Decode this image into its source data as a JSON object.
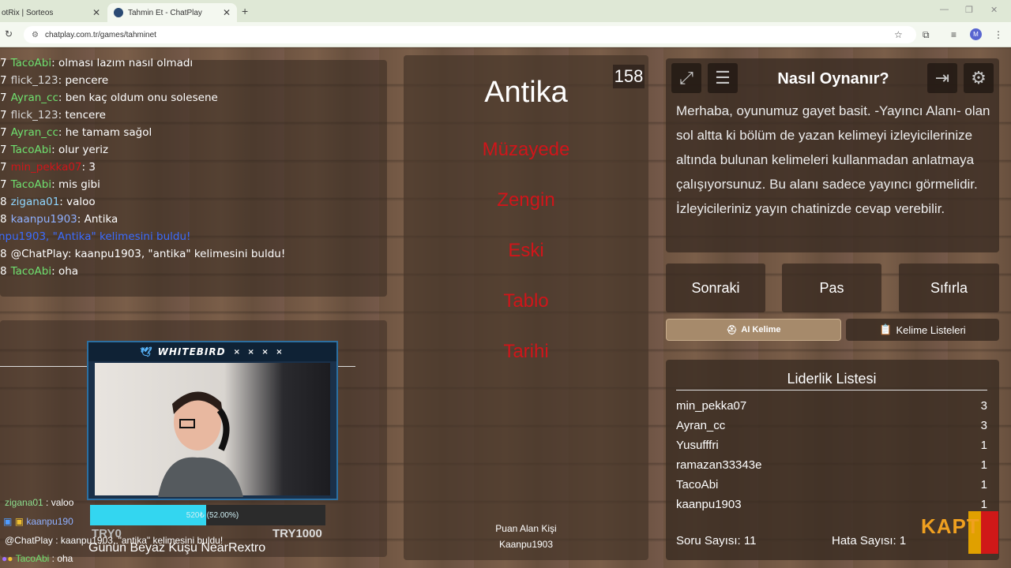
{
  "browser": {
    "tab_inactive": "otRix | Sorteos",
    "tab_active": "Tahmin Et - ChatPlay",
    "url": "chatplay.com.tr/games/tahminet",
    "avatar_letter": "M"
  },
  "chat": [
    {
      "prefix": "7",
      "user": "TacoAbi",
      "color": "#6fe06f",
      "msg": ": olması lazım nasıl olmadı"
    },
    {
      "prefix": "7",
      "user": "flick_123",
      "color": "#d8d8d8",
      "msg": ": pencere"
    },
    {
      "prefix": "7",
      "user": "Ayran_cc",
      "color": "#6fe06f",
      "msg": ": ben kaç oldum onu solesene"
    },
    {
      "prefix": "7",
      "user": "flick_123",
      "color": "#d8d8d8",
      "msg": ": tencere"
    },
    {
      "prefix": "7",
      "user": "Ayran_cc",
      "color": "#6fe06f",
      "msg": ": he tamam sağol"
    },
    {
      "prefix": "7",
      "user": "TacoAbi",
      "color": "#6fe06f",
      "msg": ": olur yeriz"
    },
    {
      "prefix": "7",
      "user": "min_pekka07",
      "color": "#d0151a",
      "msg": ": 3"
    },
    {
      "prefix": "7",
      "user": "TacoAbi",
      "color": "#6fe06f",
      "msg": ": mis gibi"
    },
    {
      "prefix": "8",
      "user": "zigana01",
      "color": "#8fd6ff",
      "msg": ": valoo"
    },
    {
      "prefix": "8",
      "user": "kaanpu1903",
      "color": "#8fb0ff",
      "msg": ": Antika"
    },
    {
      "prefix": "",
      "user": "",
      "color": "#3b6cff",
      "msg": "npu1903, \"Antika\" kelimesini buldu!"
    },
    {
      "prefix": "8",
      "user": "@ChatPlay",
      "color": "#ffffff",
      "msg": ": kaanpu1903, \"antika\" kelimesini buldu!"
    },
    {
      "prefix": "8",
      "user": "TacoAbi",
      "color": "#6fe06f",
      "msg": ": oha"
    }
  ],
  "overlay": {
    "cam_title": "WHITEBIRD",
    "cam_marks": "× × × ×",
    "progress_text": "520₺ (52.00%)",
    "progress_fraction": 0.52,
    "try_left": "TRY0",
    "try_right": "TRY1000",
    "line1_user": "zigana01",
    "line1_msg": " : valoo",
    "line2_user": "kaanpu190",
    "line3": "@ChatPlay : kaanpu1903, \"antika\" kelimesini buldu!",
    "caption": "Günün Beyaz Kuşu NearRextro",
    "line4_user": "TacoAbi",
    "line4_msg": " : oha"
  },
  "game": {
    "counter": "158",
    "main_word": "Antika",
    "taboo_words": [
      "Müzayede",
      "Zengin",
      "Eski",
      "Tablo",
      "Tarihi"
    ],
    "scorer_label": "Puan Alan Kişi",
    "scorer_name": "Kaanpu1903"
  },
  "howto": {
    "title": "Nasıl Oynanır?",
    "text": "Merhaba, oyunumuz gayet basit. -Yayıncı Alanı- olan sol altta ki bölüm de yazan kelimeyi izleyicilerinize altında bulunan kelimeleri kullanmadan anlatmaya çalışıyorsunuz. Bu alanı sadece yayıncı görmelidir. İzleyicileriniz yayın chatinizde cevap verebilir."
  },
  "buttons": {
    "next": "Sonraki",
    "pass": "Pas",
    "reset": "Sıfırla",
    "ai": "AI Kelime",
    "lists": "Kelime Listeleri"
  },
  "leaderboard": {
    "title": "Liderlik Listesi",
    "rows": [
      {
        "name": "min_pekka07",
        "score": "3"
      },
      {
        "name": "Ayran_cc",
        "score": "3"
      },
      {
        "name": "Yusufffri",
        "score": "1"
      },
      {
        "name": "ramazan33343e",
        "score": "1"
      },
      {
        "name": "TacoAbi",
        "score": "1"
      },
      {
        "name": "kaanpu1903",
        "score": "1"
      }
    ],
    "question_count": "Soru Sayısı: 11",
    "error_count": "Hata Sayısı: 1"
  },
  "colors": {
    "taboo": "#d0151a",
    "progress": "#33d6f0",
    "ai_button": "#a68a6b"
  },
  "logo_text": "KAPT"
}
